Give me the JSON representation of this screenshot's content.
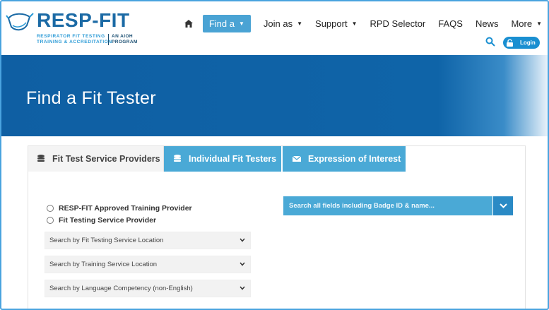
{
  "brand": {
    "title": "RESP-FIT",
    "subtitle_line1": "RESPIRATOR FIT TESTING",
    "subtitle_line2": "TRAINING & ACCREDITATION",
    "program_line1": "AN AIOH",
    "program_line2": "PROGRAM",
    "color_primary": "#1b6aa5",
    "color_accent": "#2a9ad6"
  },
  "nav": {
    "home_icon": "home-icon",
    "items": [
      {
        "label": "Find a",
        "active": true
      },
      {
        "label": "Join as"
      },
      {
        "label": "Support"
      },
      {
        "label": "RPD Selector"
      },
      {
        "label": "FAQS"
      },
      {
        "label": "News"
      },
      {
        "label": "More"
      }
    ],
    "search_icon": "search-icon",
    "login_label": "Login"
  },
  "banner": {
    "title": "Find a Fit Tester",
    "color": "#0f5fa3"
  },
  "tabs": [
    {
      "label": "Fit Test Service Providers",
      "icon": "database-icon",
      "active": true
    },
    {
      "label": "Individual Fit Testers",
      "icon": "database-icon"
    },
    {
      "label": "Expression of Interest",
      "icon": "envelope-icon"
    }
  ],
  "filters": {
    "radios": [
      {
        "label": "RESP-FIT Approved Training Provider",
        "checked": false
      },
      {
        "label": "Fit Testing Service Provider",
        "checked": false
      }
    ],
    "selects": [
      {
        "value": "Search by Fit Testing Service Location"
      },
      {
        "value": "Search by Training Service Location"
      },
      {
        "value": "Search by Language Competency (non-English)"
      }
    ],
    "search_placeholder": "Search all fields including Badge ID & name..."
  },
  "colors": {
    "tab_active_bg": "#4aa9d6",
    "nav_active_bg": "#4aa3d4",
    "login_bg": "#1a8fd1"
  }
}
